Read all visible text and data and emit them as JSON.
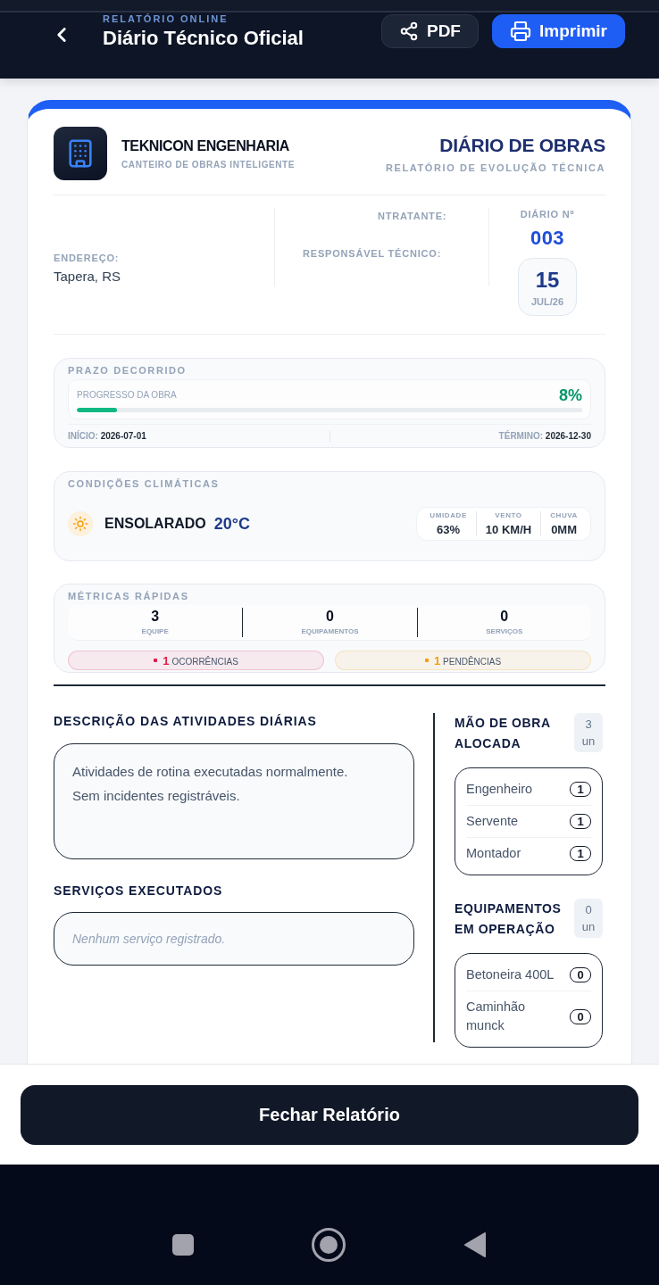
{
  "header": {
    "subtitle": "RELATÓRIO ONLINE",
    "title": "Diário Técnico Oficial",
    "buttons": [
      {
        "label": "PDF",
        "kind": "share"
      },
      {
        "label": "Imprimir",
        "kind": "print"
      }
    ]
  },
  "report": {
    "company": {
      "name": "TEKNICON ENGENHARIA",
      "tagline": "CANTEIRO DE OBRAS INTELIGENTE"
    },
    "document": {
      "title": "DIÁRIO DE OBRAS",
      "subtitle": "RELATÓRIO DE EVOLUÇÃO TÉCNICA"
    },
    "info": {
      "address_label": "ENDEREÇO:",
      "address": "Tapera, RS",
      "client_label": "NTRATANTE:",
      "technician_label": "RESPONSÁVEL TÉCNICO:",
      "number_label": "DIÁRIO Nº",
      "number": "003",
      "day": "15",
      "month_year": "JUL/26"
    },
    "schedule": {
      "title": "PRAZO DECORRIDO",
      "progress_label": "PROGRESSO DA OBRA",
      "percent": "8%",
      "level": 0.08,
      "start_label": "INÍCIO:",
      "start": "2026-07-01",
      "end_label": "TÉRMINO:",
      "end": "2026-12-30"
    },
    "weather": {
      "title": "CONDIÇÕES CLIMÁTICAS",
      "condition": "ENSOLARADO",
      "temperature": "20°C",
      "stats": [
        {
          "label": "UMIDADE",
          "value": "63%"
        },
        {
          "label": "VENTO",
          "value": "10 KM/H"
        },
        {
          "label": "CHUVA",
          "value": "0MM"
        }
      ]
    },
    "metrics": {
      "title": "MÉTRICAS RÁPIDAS",
      "items": [
        {
          "value": "3",
          "label": "EQUIPE"
        },
        {
          "value": "0",
          "label": "EQUIPAMENTOS"
        },
        {
          "value": "0",
          "label": "SERVIÇOS"
        }
      ],
      "flags": [
        {
          "count": "1",
          "label": "OCORRÊNCIAS",
          "color": "#e11d48"
        },
        {
          "count": "1",
          "label": "PENDÊNCIAS",
          "color": "#f59e0b"
        }
      ]
    },
    "activities": {
      "title": "DESCRIÇÃO DAS ATIVIDADES DIÁRIAS",
      "text": "Atividades de rotina executadas normalmente.\nSem incidentes registráveis."
    },
    "services": {
      "title": "SERVIÇOS EXECUTADOS",
      "empty_message": "Nenhum serviço registrado."
    },
    "labor": {
      "title": "MÃO DE OBRA ALOCADA",
      "count": "3",
      "unit": "un",
      "items": [
        {
          "name": "Engenheiro",
          "count": "1"
        },
        {
          "name": "Servente",
          "count": "1"
        },
        {
          "name": "Montador",
          "count": "1"
        }
      ]
    },
    "equipment": {
      "title": "EQUIPAMENTOS EM OPERAÇÃO",
      "count": "0",
      "unit": "un",
      "items": [
        {
          "name": "Betoneira 400L",
          "count": "0"
        },
        {
          "name": "Caminhão munck",
          "count": "0"
        }
      ]
    }
  },
  "footer": {
    "button": "Fechar Relatório"
  }
}
